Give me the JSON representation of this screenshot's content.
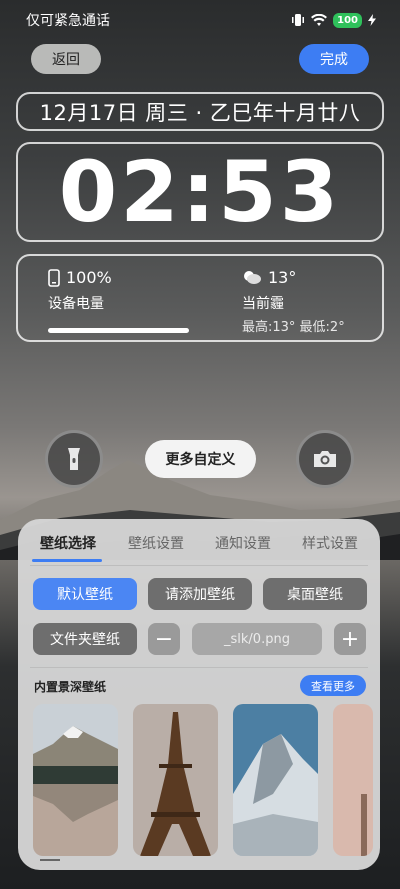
{
  "status_bar": {
    "left_text": "仅可紧急通话",
    "battery": "100"
  },
  "header": {
    "back_label": "返回",
    "done_label": "完成"
  },
  "lockscreen": {
    "date_text": "12月17日 周三 · 乙巳年十月廿八",
    "time_text": "02:53",
    "battery_percent": "100%",
    "battery_label": "设备电量",
    "battery_level": 1.0,
    "temperature": "13°",
    "weather_label": "当前霾",
    "weather_range": "最高:13° 最低:2°"
  },
  "quick_actions": {
    "flashlight_icon": "flashlight-icon",
    "camera_icon": "camera-icon",
    "customize_label": "更多自定义"
  },
  "panel": {
    "tabs": [
      {
        "label": "壁纸选择",
        "active": true
      },
      {
        "label": "壁纸设置",
        "active": false
      },
      {
        "label": "通知设置",
        "active": false
      },
      {
        "label": "样式设置",
        "active": false
      }
    ],
    "wallpaper_options": {
      "default_label": "默认壁纸",
      "add_label": "请添加壁纸",
      "desktop_label": "桌面壁纸",
      "folder_label": "文件夹壁纸",
      "minus_label": "−",
      "plus_label": "+",
      "path_placeholder": "_slk/0.png"
    },
    "builtin": {
      "title": "内置景深壁纸",
      "more_label": "查看更多"
    }
  },
  "colors": {
    "accent": "#3d7df3",
    "battery_green": "#2fc15b"
  }
}
